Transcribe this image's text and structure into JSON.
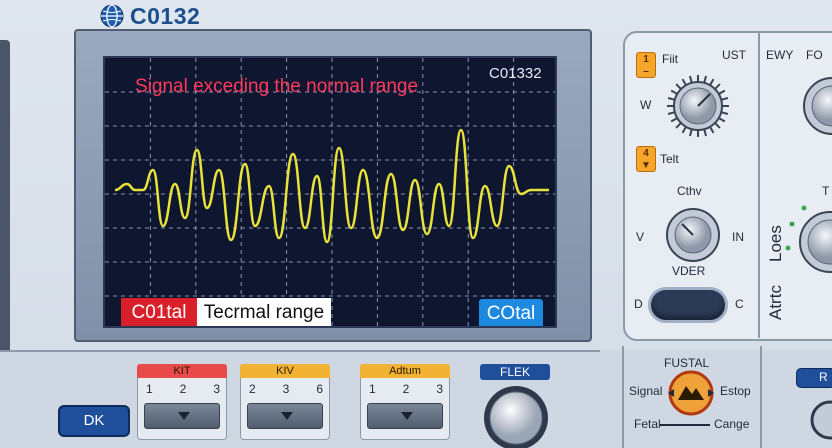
{
  "brand": {
    "title": "C0132"
  },
  "screen": {
    "warning": "Signal exceding the normal range",
    "code": "C01332",
    "label_left": "C01tal",
    "label_mid": "Tecrmal range",
    "label_right": "COtal"
  },
  "trace_color": "#e8e23a",
  "controls": {
    "btn1": "1",
    "btn1_label": "Fiit",
    "ust": "UST",
    "ewy": "EWY",
    "fo": "FO",
    "w": "W",
    "btn2": "4",
    "btn2_label": "Telt",
    "cthv": "Cthv",
    "v": "V",
    "in": "IN",
    "vder": "VDER",
    "d": "D",
    "c": "C",
    "t": "T",
    "vert1": "Loes",
    "vert2": "Atrtc"
  },
  "bottom": {
    "groups": [
      {
        "head": "KIT",
        "nums": [
          "1",
          "2",
          "3"
        ],
        "color": "#e84a4a"
      },
      {
        "head": "KIV",
        "nums": [
          "2",
          "3",
          "6"
        ],
        "color": "#f2b233"
      },
      {
        "head": "Adtum",
        "nums": [
          "1",
          "2",
          "3"
        ],
        "color": "#f2b233"
      }
    ],
    "dk": "DK",
    "flek": "FLEK",
    "fustal": "FUSTAL",
    "signal": "Signal",
    "estop": "Estop",
    "fetal": "Fetal",
    "cange": "Cange",
    "r": "R"
  }
}
